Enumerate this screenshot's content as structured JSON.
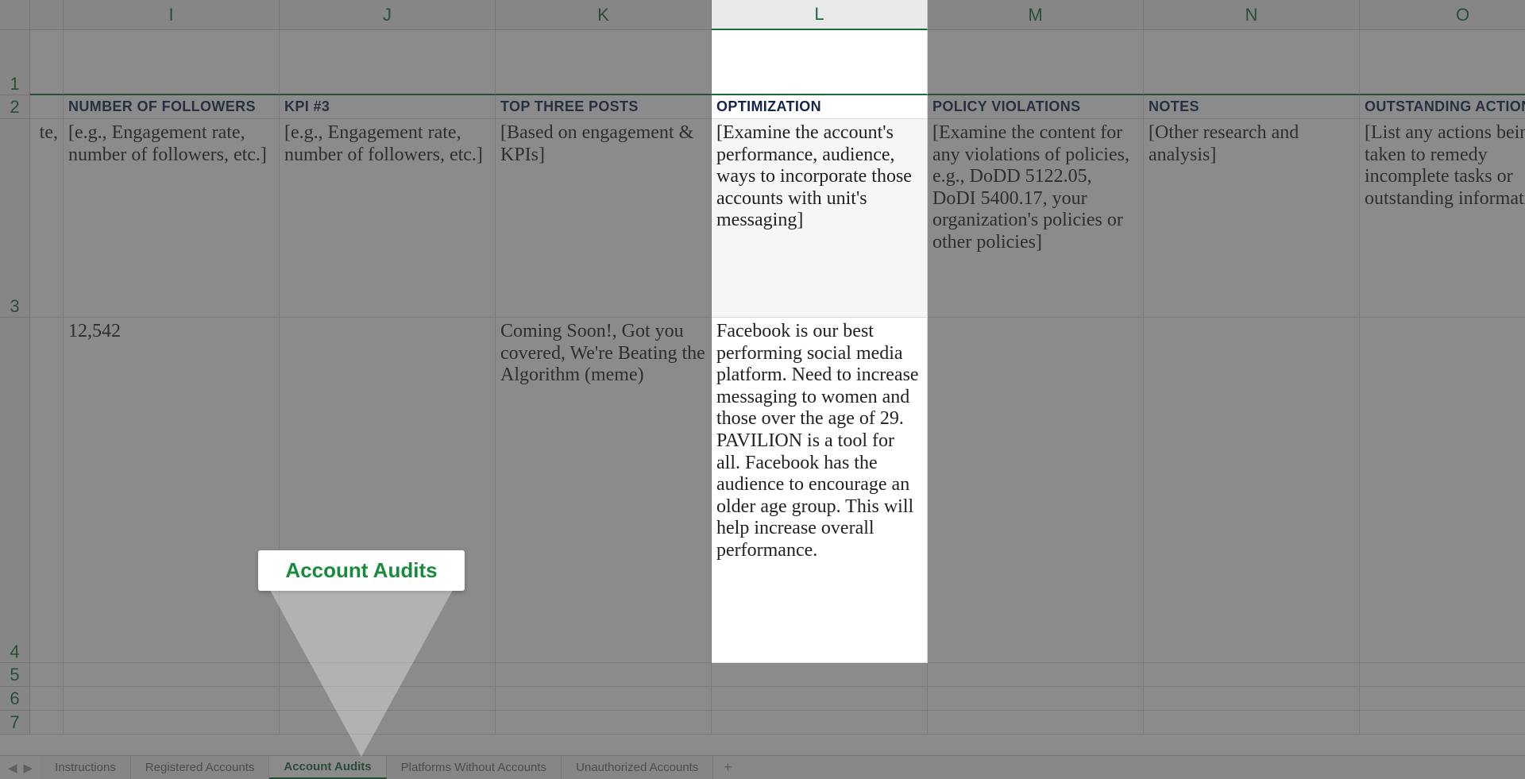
{
  "columns": {
    "I": "I",
    "J": "J",
    "K": "K",
    "L": "L",
    "M": "M",
    "N": "N",
    "O": "O"
  },
  "rows": [
    "1",
    "2",
    "3",
    "4",
    "5",
    "6",
    "7"
  ],
  "headers": {
    "I": "NUMBER OF FOLLOWERS",
    "J": "KPI #3",
    "K": "TOP THREE POSTS",
    "L": "OPTIMIZATION",
    "M": "POLICY VIOLATIONS",
    "N": "NOTES",
    "O": "OUTSTANDING ACTIONS"
  },
  "row3": {
    "H_trail": "te,",
    "I": "[e.g., Engagement rate, number of followers, etc.]",
    "J": "[e.g., Engagement rate, number of followers, etc.]",
    "K": "[Based on engagement & KPIs]",
    "L": "[Examine the account's performance, audience, ways to incorporate those accounts with unit's messaging]",
    "M": "[Examine the content for any violations of policies, e.g., DoDD 5122.05, DoDI 5400.17, your organization's policies or other policies]",
    "N": "[Other research and analysis]",
    "O": "[List any actions being taken to remedy incomplete tasks or outstanding information]"
  },
  "row4": {
    "I": "12,542",
    "K": "Coming Soon!, Got you covered, We're Beating the Algorithm (meme)",
    "L": "Facebook is our best performing social media platform. Need to increase messaging to women and those over the age of 29. PAVILION is a tool for all. Facebook has the audience to encourage an older age group. This will help increase overall performance."
  },
  "callout": "Account Audits",
  "tabs": {
    "nav_prev": "◀",
    "nav_next": "▶",
    "items": [
      "Instructions",
      "Registered Accounts",
      "Account Audits",
      "Platforms Without Accounts",
      "Unauthorized Accounts"
    ],
    "active_index": 2,
    "add": "+"
  }
}
